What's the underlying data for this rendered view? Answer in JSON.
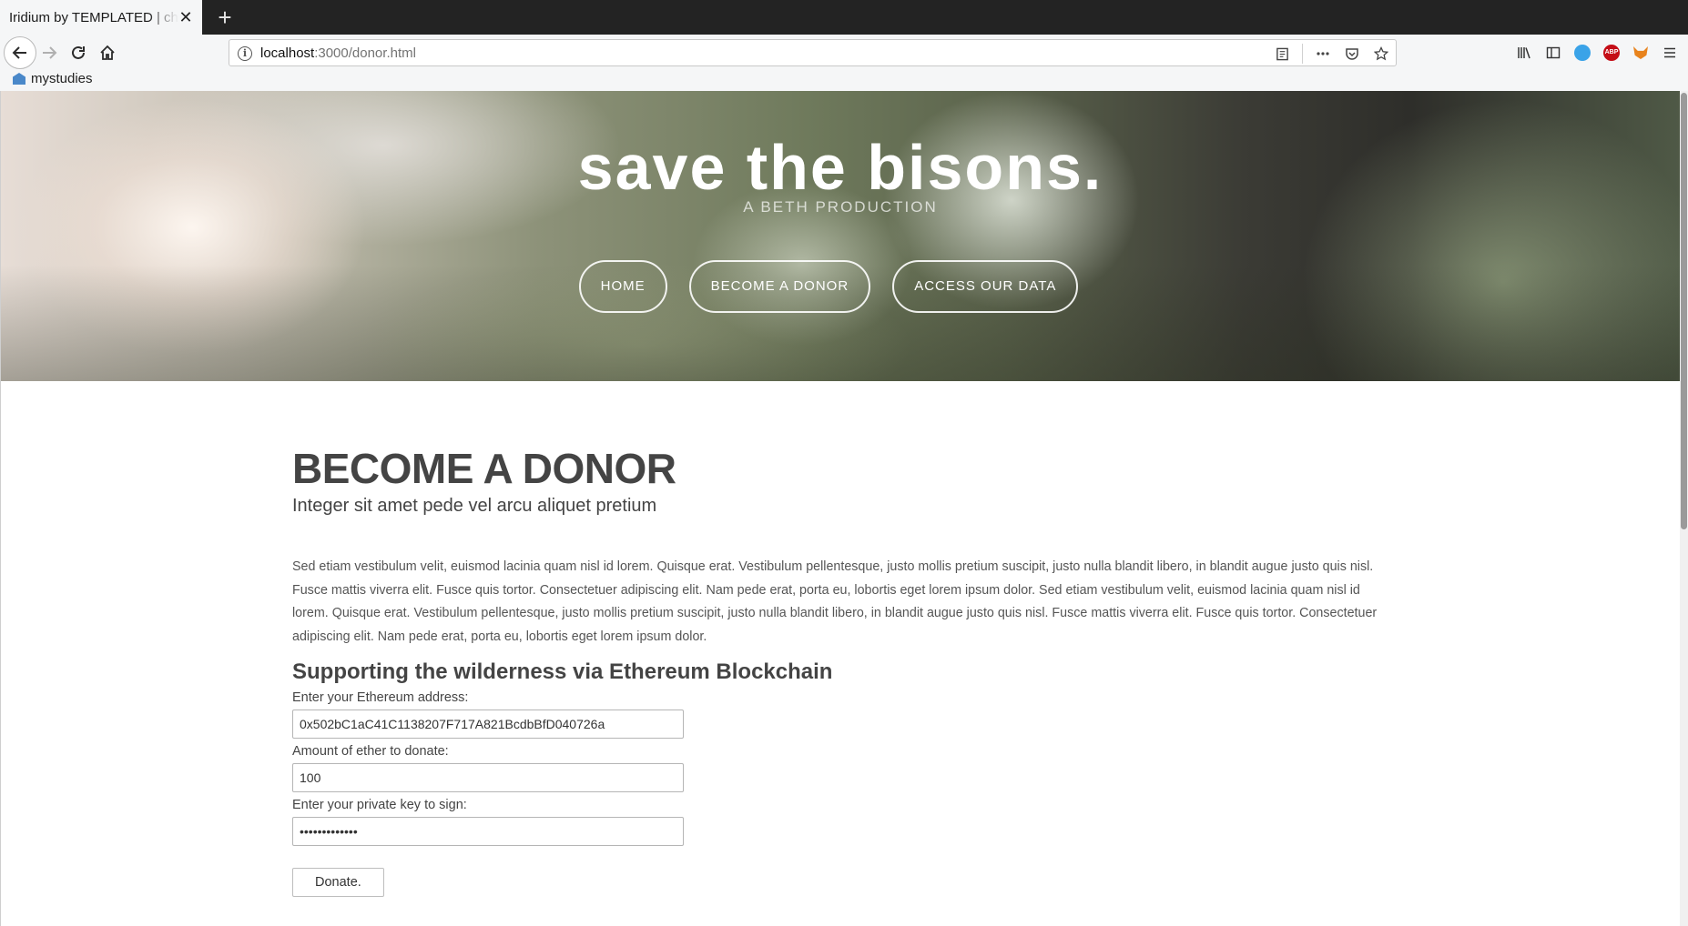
{
  "browser": {
    "tab_title": "Iridium by TEMPLATED | chat",
    "tab_close": "✕",
    "new_tab": "+",
    "url_host": "localhost",
    "url_path": ":3000/donor.html",
    "bookmark_label": "mystudies",
    "abp_label": "ABP"
  },
  "banner": {
    "title": "save the bisons.",
    "subtitle": "A BETH PRODUCTION",
    "nav": {
      "home": "HOME",
      "donor": "BECOME A DONOR",
      "data": "ACCESS OUR DATA"
    }
  },
  "main": {
    "heading": "BECOME A DONOR",
    "subheading": "Integer sit amet pede vel arcu aliquet pretium",
    "body": "Sed etiam vestibulum velit, euismod lacinia quam nisl id lorem. Quisque erat. Vestibulum pellentesque, justo mollis pretium suscipit, justo nulla blandit libero, in blandit augue justo quis nisl. Fusce mattis viverra elit. Fusce quis tortor. Consectetuer adipiscing elit. Nam pede erat, porta eu, lobortis eget lorem ipsum dolor. Sed etiam vestibulum velit, euismod lacinia quam nisl id lorem. Quisque erat. Vestibulum pellentesque, justo mollis pretium suscipit, justo nulla blandit libero, in blandit augue justo quis nisl. Fusce mattis viverra elit. Fusce quis tortor. Consectetuer adipiscing elit. Nam pede erat, porta eu, lobortis eget lorem ipsum dolor.",
    "section_heading": "Supporting the wilderness via Ethereum Blockchain",
    "form": {
      "address_label": "Enter your Ethereum address:",
      "address_value": "0x502bC1aC41C1138207F717A821BcdbBfD040726a",
      "amount_label": "Amount of ether to donate:",
      "amount_value": "100",
      "key_label": "Enter your private key to sign:",
      "key_value": "•••••••••••••",
      "donate_label": "Donate."
    }
  }
}
